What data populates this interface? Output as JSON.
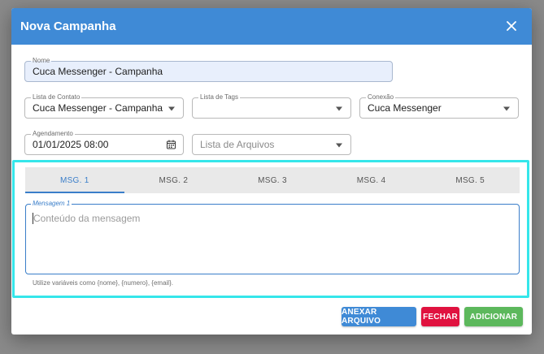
{
  "dialog": {
    "title": "Nova Campanha",
    "close_icon": "close-icon"
  },
  "form": {
    "nome": {
      "label": "Nome",
      "value": "Cuca Messenger - Campanha"
    },
    "lista_contato": {
      "label": "Lista de Contato",
      "value": "Cuca Messenger - Campanha"
    },
    "lista_tags": {
      "label": "Lista de Tags",
      "value": ""
    },
    "conexao": {
      "label": "Conexão",
      "value": "Cuca Messenger"
    },
    "agendamento": {
      "label": "Agendamento",
      "value": "01/01/2025 08:00"
    },
    "lista_arquivos": {
      "placeholder": "Lista de Arquivos"
    }
  },
  "messages": {
    "tabs": [
      "MSG. 1",
      "MSG. 2",
      "MSG. 3",
      "MSG. 4",
      "MSG. 5"
    ],
    "active_tab": 0,
    "field_label": "Mensagem 1",
    "placeholder": "Conteúdo da mensagem",
    "helper": "Utilize variáveis como {nome}, {numero}, {email}."
  },
  "actions": {
    "attach": "ANEXAR ARQUIVO",
    "close": "FECHAR",
    "add": "ADICIONAR"
  },
  "colors": {
    "header": "#3f8ad6",
    "attach": "#3f8ad6",
    "close": "#e0123f",
    "add": "#5cb85c",
    "highlight": "#35e6ea"
  }
}
